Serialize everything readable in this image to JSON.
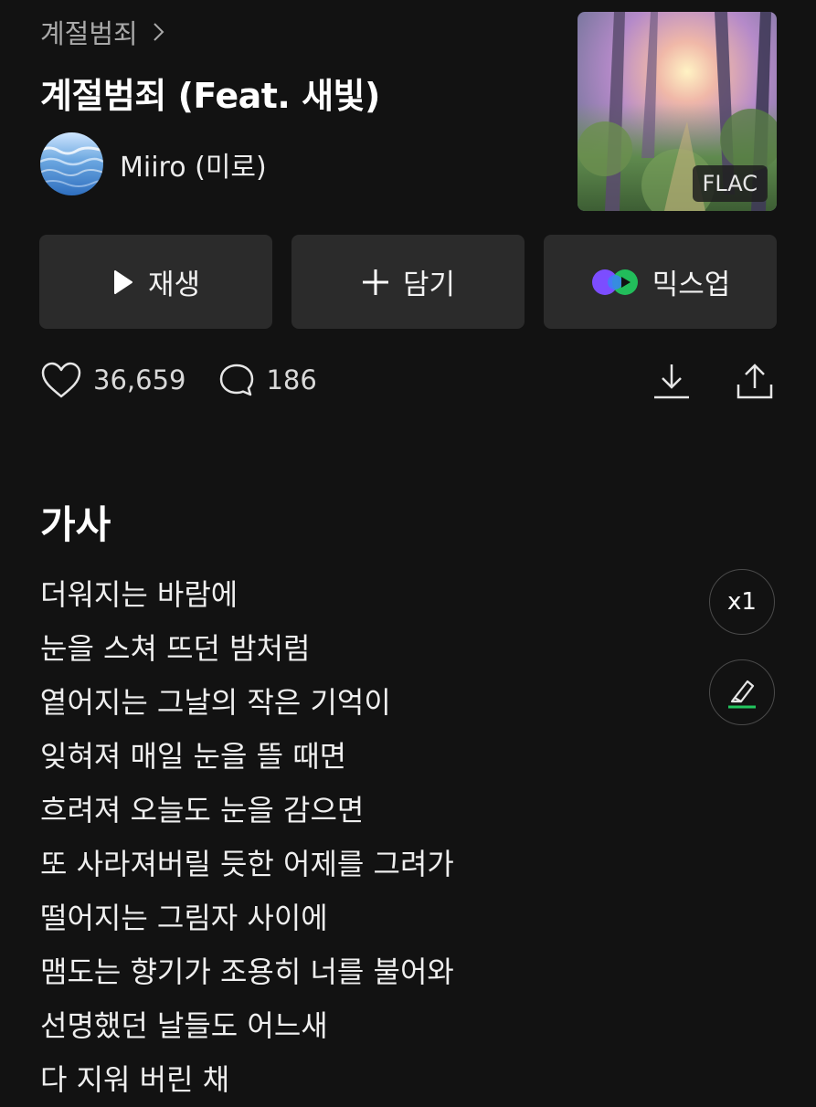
{
  "album": {
    "name": "계절범죄"
  },
  "song": {
    "title": "계절범죄 (Feat. 새빛)",
    "quality_badge": "FLAC"
  },
  "artist": {
    "name": "Miiro (미로)"
  },
  "actions": {
    "play_label": "재생",
    "add_label": "담기",
    "mixup_label": "믹스업"
  },
  "stats": {
    "likes": "36,659",
    "comments": "186"
  },
  "lyrics": {
    "heading": "가사",
    "speed_label": "x1",
    "lines": [
      "더워지는 바람에",
      "눈을 스쳐 뜨던 밤처럼",
      "옅어지는 그날의 작은 기억이",
      "잊혀져 매일 눈을 뜰 때면",
      "흐려져 오늘도 눈을 감으면",
      "또 사라져버릴 듯한 어제를 그려가",
      "떨어지는 그림자 사이에",
      "맴도는 향기가 조용히 너를 불어와",
      "선명했던 날들도 어느새",
      "다 지워 버린 채"
    ]
  },
  "colors": {
    "background": "#121212",
    "button_bg": "#2b2b2b",
    "highlight_green": "#22c55e",
    "secondary_text": "#a9a9a9"
  },
  "icons": [
    "chevron-right-icon",
    "play-icon",
    "plus-icon",
    "mixup-icon",
    "heart-icon",
    "comment-icon",
    "download-icon",
    "share-icon",
    "highlighter-icon"
  ]
}
